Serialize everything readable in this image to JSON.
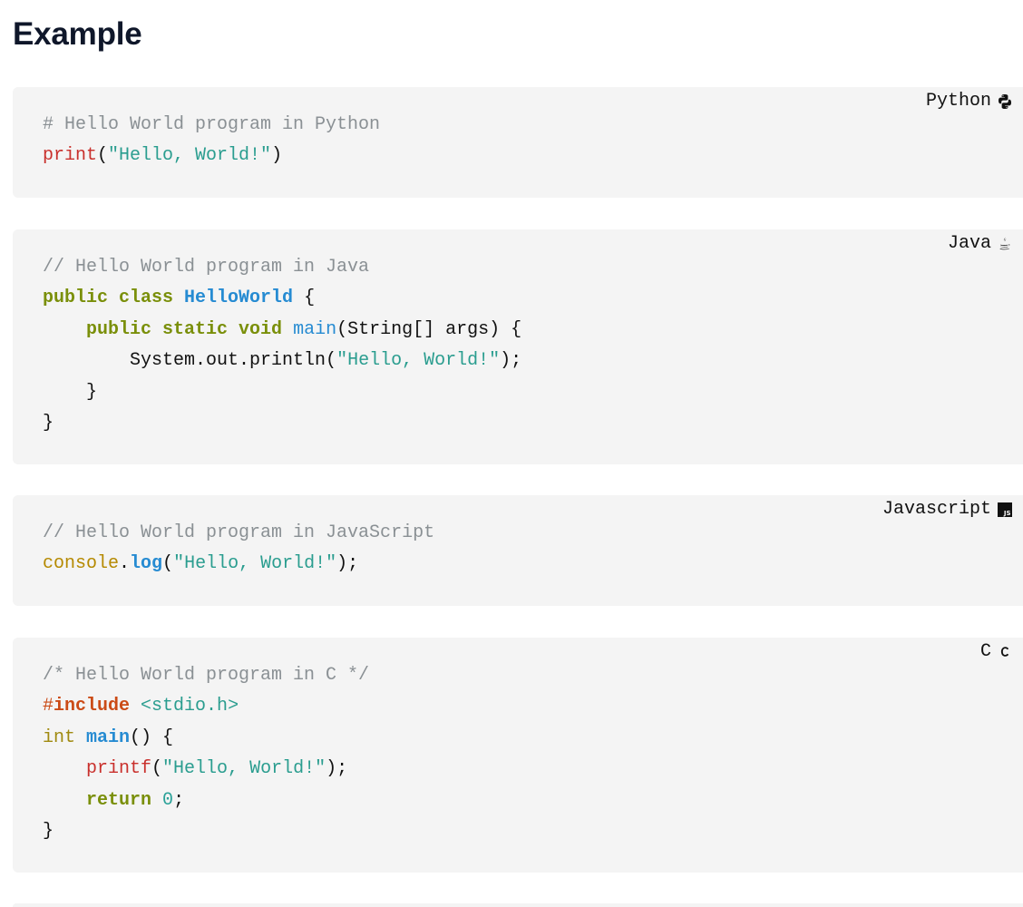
{
  "page": {
    "title": "Example"
  },
  "blocks": [
    {
      "language": "Python",
      "icon": "python-icon",
      "lines": [
        [
          {
            "t": "# Hello World program in Python",
            "c": "comment"
          }
        ],
        [
          {
            "t": "print",
            "c": "builtin"
          },
          {
            "t": "(",
            "c": "plain"
          },
          {
            "t": "\"Hello, World!\"",
            "c": "string"
          },
          {
            "t": ")",
            "c": "plain"
          }
        ]
      ]
    },
    {
      "language": "Java",
      "icon": "java-icon",
      "lines": [
        [
          {
            "t": "// Hello World program in Java",
            "c": "comment"
          }
        ],
        [
          {
            "t": "public class ",
            "c": "keyword"
          },
          {
            "t": "HelloWorld",
            "c": "class"
          },
          {
            "t": " {",
            "c": "plain"
          }
        ],
        [
          {
            "t": "    ",
            "c": "plain"
          },
          {
            "t": "public static void ",
            "c": "keyword"
          },
          {
            "t": "main",
            "c": "func"
          },
          {
            "t": "(String[] args) {",
            "c": "plain"
          }
        ],
        [
          {
            "t": "        System.out.println(",
            "c": "plain"
          },
          {
            "t": "\"Hello, World!\"",
            "c": "string"
          },
          {
            "t": ");",
            "c": "plain"
          }
        ],
        [
          {
            "t": "    }",
            "c": "plain"
          }
        ],
        [
          {
            "t": "}",
            "c": "plain"
          }
        ]
      ]
    },
    {
      "language": "Javascript",
      "icon": "javascript-icon",
      "lines": [
        [
          {
            "t": "// Hello World program in JavaScript",
            "c": "comment"
          }
        ],
        [
          {
            "t": "console",
            "c": "var"
          },
          {
            "t": ".",
            "c": "plain"
          },
          {
            "t": "log",
            "c": "func-b"
          },
          {
            "t": "(",
            "c": "plain"
          },
          {
            "t": "\"Hello, World!\"",
            "c": "string"
          },
          {
            "t": ");",
            "c": "plain"
          }
        ]
      ]
    },
    {
      "language": "C",
      "icon": "c-language-icon",
      "lines": [
        [
          {
            "t": "/* Hello World program in C */",
            "c": "comment"
          }
        ],
        [
          {
            "t": "#",
            "c": "pre"
          },
          {
            "t": "include",
            "c": "pre-b"
          },
          {
            "t": " ",
            "c": "plain"
          },
          {
            "t": "<stdio.h>",
            "c": "string"
          }
        ],
        [
          {
            "t": "int",
            "c": "type"
          },
          {
            "t": " ",
            "c": "plain"
          },
          {
            "t": "main",
            "c": "func-b"
          },
          {
            "t": "() {",
            "c": "plain"
          }
        ],
        [
          {
            "t": "    ",
            "c": "plain"
          },
          {
            "t": "printf",
            "c": "builtin"
          },
          {
            "t": "(",
            "c": "plain"
          },
          {
            "t": "\"Hello, World!\"",
            "c": "string"
          },
          {
            "t": ");",
            "c": "plain"
          }
        ],
        [
          {
            "t": "    ",
            "c": "plain"
          },
          {
            "t": "return",
            "c": "keyword"
          },
          {
            "t": " ",
            "c": "plain"
          },
          {
            "t": "0",
            "c": "num"
          },
          {
            "t": ";",
            "c": "plain"
          }
        ],
        [
          {
            "t": "}",
            "c": "plain"
          }
        ]
      ]
    }
  ]
}
